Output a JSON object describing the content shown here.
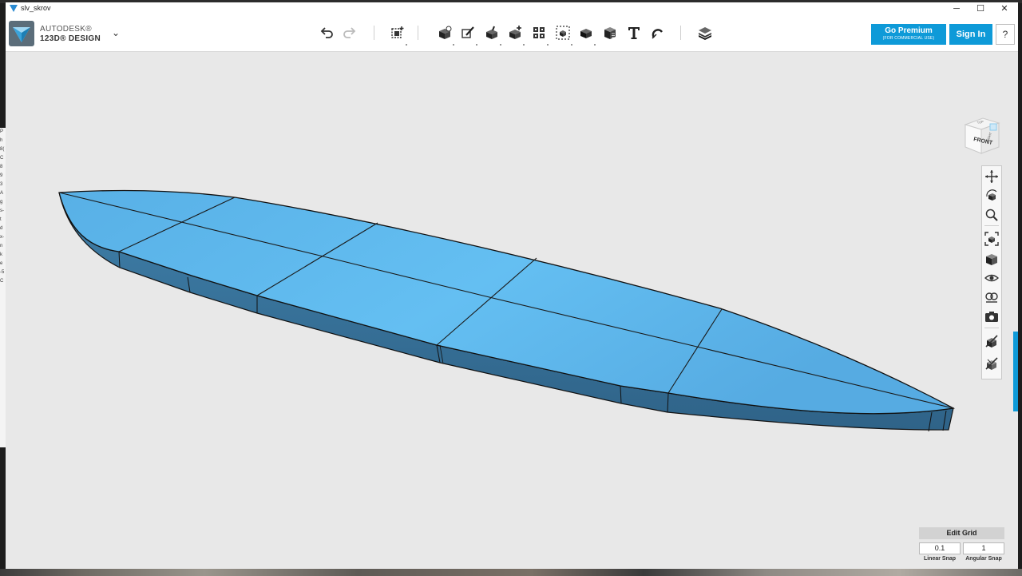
{
  "window": {
    "title": "slv_skrov",
    "controls": [
      "─",
      "☐",
      "✕"
    ]
  },
  "brand": {
    "line1": "AUTODESK®",
    "line2": "123D® DESIGN"
  },
  "toolbar": {
    "tools": [
      {
        "name": "undo-icon",
        "glyph": "↶"
      },
      {
        "name": "redo-icon",
        "glyph": "↷"
      },
      {
        "name": "transform-icon"
      },
      {
        "name": "primitives-icon"
      },
      {
        "name": "sketch-icon"
      },
      {
        "name": "construct-icon"
      },
      {
        "name": "modify-icon"
      },
      {
        "name": "pattern-icon"
      },
      {
        "name": "group-icon"
      },
      {
        "name": "combine-icon"
      },
      {
        "name": "measure-icon"
      },
      {
        "name": "text-icon",
        "glyph": "T"
      },
      {
        "name": "snap-icon"
      },
      {
        "name": "material-icon"
      }
    ]
  },
  "account": {
    "premium_label": "Go Premium",
    "premium_sub": "(FOR COMMERCIAL USE)",
    "signin_label": "Sign In",
    "help_label": "?"
  },
  "viewcube": {
    "face_front": "FRONT",
    "face_top": "TOP",
    "face_right": "RIGHT"
  },
  "nav_tools": [
    "pan-icon",
    "orbit-icon",
    "zoom-icon",
    "fit-icon",
    "views-icon",
    "visibility-icon",
    "materials-outlines-icon",
    "screenshot-icon",
    "hide-sketches-icon",
    "hide-meshes-icon"
  ],
  "grid": {
    "edit_label": "Edit Grid",
    "linear_value": "0.1",
    "angular_value": "1",
    "linear_label": "Linear Snap",
    "angular_label": "Angular Snap"
  },
  "colors": {
    "accent": "#0e9ad8",
    "hull_top": "#5db5ec",
    "hull_side": "#3d7aa3",
    "viewport_bg": "#e8e8e8"
  },
  "left_peek_chars": [
    "P",
    "h",
    "8(",
    "C",
    "8",
    "9",
    "3",
    "A",
    "",
    "g",
    "s-",
    "t",
    "",
    "d",
    "x-",
    "n",
    "k",
    "e",
    "-5",
    "C"
  ]
}
